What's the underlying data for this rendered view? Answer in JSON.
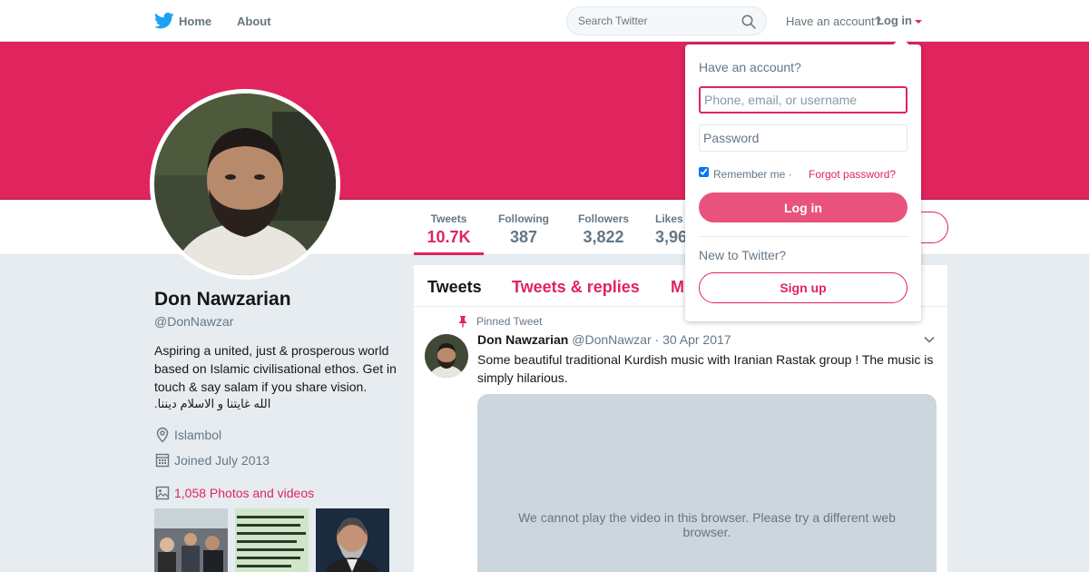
{
  "colors": {
    "accent": "#e0245e",
    "banner": "#e0245e",
    "login_button": "#e9527c",
    "twitter_blue": "#1da1f2",
    "page_background": "#e6ecf0",
    "secondary_text": "#657786"
  },
  "nav": {
    "logo_icon": "twitter-bird-icon",
    "home_label": "Home",
    "about_label": "About",
    "search_placeholder": "Search Twitter",
    "search_icon": "search-icon",
    "account_prompt": "Have an account?",
    "login_label": "Log in"
  },
  "profile": {
    "name": "Don Nawzarian",
    "handle": "@DonNawzar",
    "bio": "Aspiring a united, just & prosperous world based on Islamic civilisational ethos. Get in touch & say salam if you share vision.",
    "bio_arabic": "الله غايتنا و الاسلام ديننا.",
    "location": "Islambol",
    "joined": "Joined July 2013",
    "photos_label": "1,058 Photos and videos"
  },
  "stats": [
    {
      "label": "Tweets",
      "value": "10.7K"
    },
    {
      "label": "Following",
      "value": "387"
    },
    {
      "label": "Followers",
      "value": "3,822"
    },
    {
      "label": "Likes",
      "value": "3,96"
    }
  ],
  "timeline": {
    "tabs": [
      "Tweets",
      "Tweets & replies",
      "M"
    ],
    "pinned_label": "Pinned Tweet",
    "tweet": {
      "name": "Don Nawzarian",
      "handle": "@DonNawzar",
      "separator": "·",
      "date": "30 Apr 2017",
      "text": "Some beautiful traditional Kurdish music with Iranian Rastak group ! The music is simply hilarious.",
      "video_message": "We cannot play the video in this browser. Please try a different web browser."
    }
  },
  "login_dropdown": {
    "title": "Have an account?",
    "username_placeholder": "Phone, email, or username",
    "password_placeholder": "Password",
    "remember_label": "Remember me",
    "separator": "·",
    "forgot_label": "Forgot password?",
    "login_button": "Log in",
    "new_prompt": "New to Twitter?",
    "signup_button": "Sign up"
  }
}
